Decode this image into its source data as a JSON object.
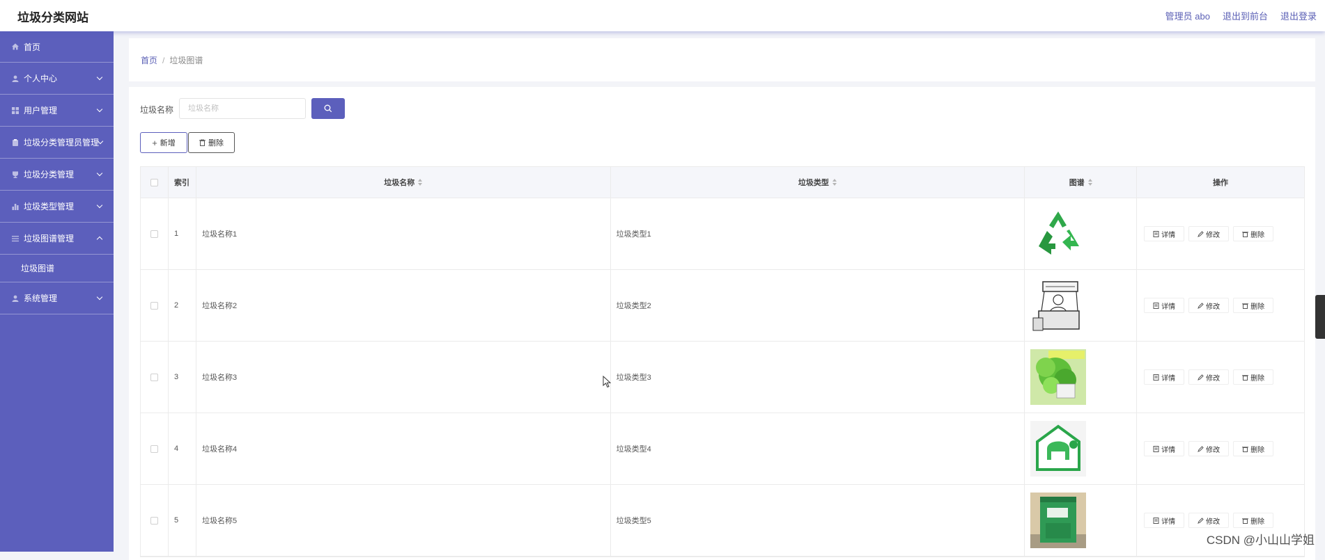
{
  "header": {
    "brand": "垃圾分类网站",
    "admin_label": "管理员 abo",
    "front_link": "退出到前台",
    "logout_link": "退出登录"
  },
  "sidebar": {
    "items": [
      {
        "label": "首页",
        "icon": "home-icon"
      },
      {
        "label": "个人中心",
        "icon": "user-icon"
      },
      {
        "label": "用户管理",
        "icon": "grid-icon"
      },
      {
        "label": "垃圾分类管理员管理",
        "icon": "clipboard-icon"
      },
      {
        "label": "垃圾分类管理",
        "icon": "trophy-icon"
      },
      {
        "label": "垃圾类型管理",
        "icon": "bar-chart-icon"
      },
      {
        "label": "垃圾图谱管理",
        "icon": "list-icon",
        "expanded": true,
        "sub": [
          "垃圾图谱"
        ]
      },
      {
        "label": "系统管理",
        "icon": "user-icon"
      }
    ],
    "accent": "#5c5fbc"
  },
  "breadcrumb": {
    "home": "首页",
    "sep": "/",
    "current": "垃圾图谱"
  },
  "search": {
    "label": "垃圾名称",
    "placeholder": "垃圾名称",
    "icon": "search-icon"
  },
  "actions": {
    "add": "新增",
    "delete": "删除"
  },
  "table": {
    "headers": {
      "index": "索引",
      "name": "垃圾名称",
      "type": "垃圾类型",
      "image": "图谱",
      "ops": "操作"
    },
    "rows": [
      {
        "index": "1",
        "name": "垃圾名称1",
        "type": "垃圾类型1",
        "image": "recycle-symbol"
      },
      {
        "index": "2",
        "name": "垃圾名称2",
        "type": "垃圾类型2",
        "image": "sketch-kiosk"
      },
      {
        "index": "3",
        "name": "垃圾名称3",
        "type": "垃圾类型3",
        "image": "green-leaves-poster"
      },
      {
        "index": "4",
        "name": "垃圾名称4",
        "type": "垃圾类型4",
        "image": "green-recycle-house"
      },
      {
        "index": "5",
        "name": "垃圾名称5",
        "type": "垃圾类型5",
        "image": "green-bin"
      }
    ],
    "row_actions": {
      "detail": "详情",
      "edit": "修改",
      "delete": "删除"
    }
  },
  "watermark": "CSDN @小山山学姐"
}
